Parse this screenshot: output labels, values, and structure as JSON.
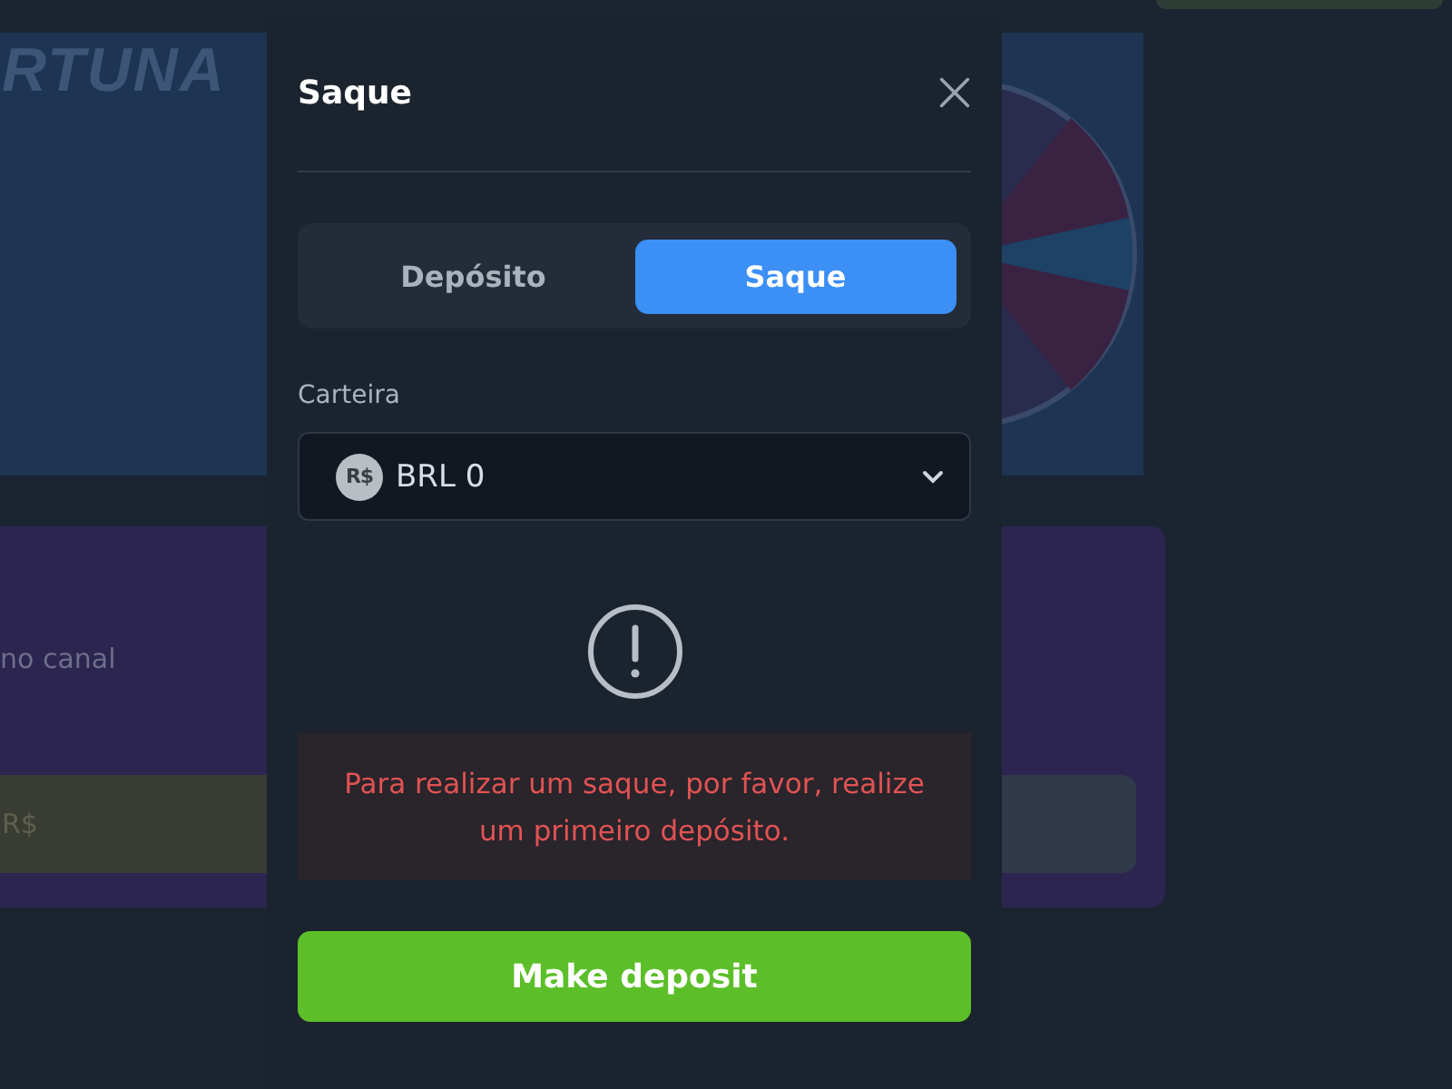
{
  "background": {
    "banner_title": "RTUNA",
    "promo_text": "no canal",
    "promo_button": "R$"
  },
  "modal": {
    "title": "Saque",
    "tabs": [
      {
        "label": "Depósito",
        "selected": false
      },
      {
        "label": "Saque",
        "selected": true
      }
    ],
    "wallet_label": "Carteira",
    "wallet": {
      "currency_icon": "R$",
      "value": "BRL 0"
    },
    "notice": "Para realizar um saque, por favor, realize um primeiro depósito.",
    "button": "Make deposit"
  }
}
